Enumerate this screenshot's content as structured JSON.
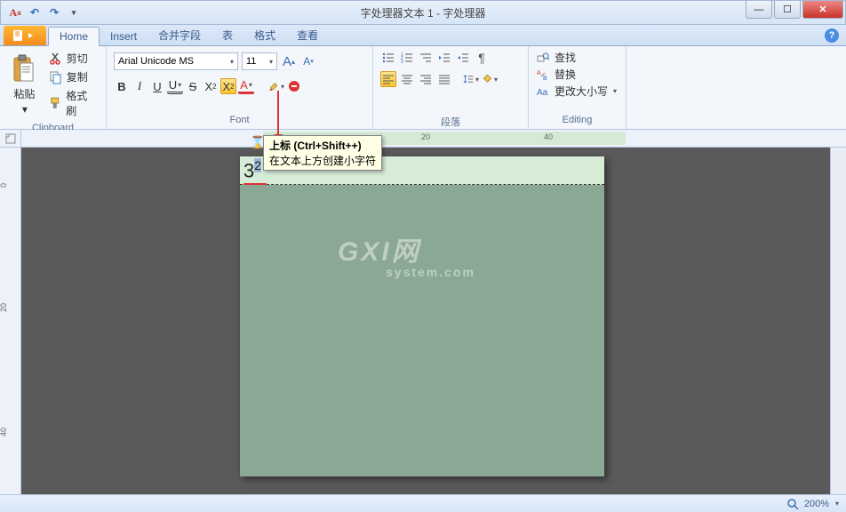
{
  "title": "字处理器文本 1 - 字处理器",
  "tabs": {
    "file": "",
    "home": "Home",
    "insert": "Insert",
    "merge": "合并字段",
    "table": "表",
    "format": "格式",
    "view": "查看"
  },
  "clipboard": {
    "paste": "粘贴",
    "cut": "剪切",
    "copy": "复制",
    "format_painter": "格式刷",
    "label": "Clipboard"
  },
  "font": {
    "name": "Arial Unicode MS",
    "size": "11",
    "grow": "A",
    "shrink": "A",
    "bold": "B",
    "italic": "I",
    "underline": "U",
    "double_u": "U",
    "strike": "S",
    "sub": "X₂",
    "sup": "X²",
    "label": "Font"
  },
  "para": {
    "label": "段落"
  },
  "editing": {
    "find": "查找",
    "replace": "替换",
    "case": "更改大小写",
    "label": "Editing"
  },
  "tooltip": {
    "title": "上标 (Ctrl+Shift++)",
    "desc": "在文本上方创建小字符"
  },
  "ruler": {
    "m20": "20",
    "m40": "40"
  },
  "vruler": {
    "m0": "0",
    "m20": "20",
    "m40": "40"
  },
  "document": {
    "base": "3",
    "sup": "2"
  },
  "watermark": {
    "main": "GXI网",
    "sub": "system.com"
  },
  "status": {
    "zoom": "200%"
  }
}
